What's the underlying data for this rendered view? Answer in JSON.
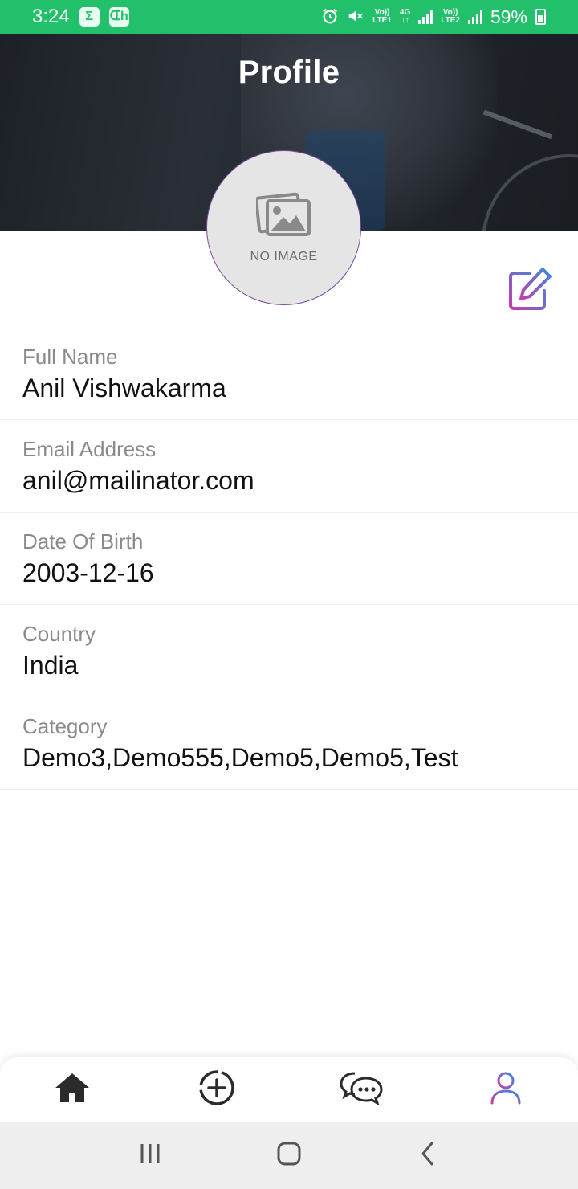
{
  "status_bar": {
    "time": "3:24",
    "app_icons": [
      "Σ",
      "ᗭh"
    ],
    "network_1": {
      "top": "Vo))",
      "bottom": "LTE1"
    },
    "network_type": {
      "top": "4G",
      "bottom": "↓↑"
    },
    "network_2": {
      "top": "Vo))",
      "bottom": "LTE2"
    },
    "battery_percent": "59%",
    "icons": [
      "alarm-icon",
      "mute-icon",
      "signal-icon",
      "battery-icon"
    ]
  },
  "header": {
    "title": "Profile"
  },
  "avatar": {
    "placeholder_label": "NO IMAGE"
  },
  "fields": [
    {
      "label": "Full Name",
      "value": "Anil Vishwakarma"
    },
    {
      "label": "Email Address",
      "value": "anil@mailinator.com"
    },
    {
      "label": "Date Of Birth",
      "value": "2003-12-16"
    },
    {
      "label": "Country",
      "value": "India"
    },
    {
      "label": "Category",
      "value": "Demo3,Demo555,Demo5,Demo5,Test"
    }
  ],
  "bottom_nav": {
    "items": [
      "home-icon",
      "add-circle-icon",
      "chat-icon",
      "profile-icon"
    ],
    "active": "profile-icon"
  },
  "colors": {
    "status_bar": "#22c06a",
    "accent_gradient_start": "#c43ea8",
    "accent_gradient_end": "#3a8be0"
  }
}
